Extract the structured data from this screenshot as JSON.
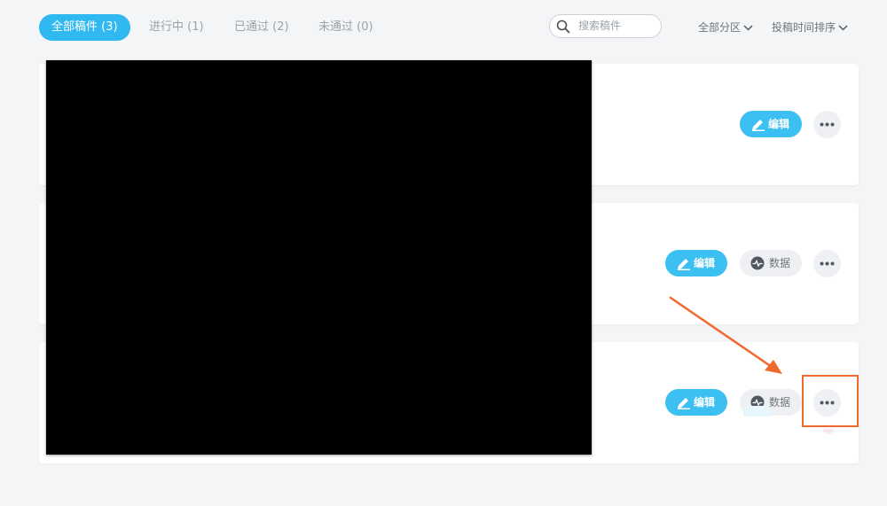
{
  "tabs": [
    {
      "label": "全部稿件 (3)",
      "active": true
    },
    {
      "label": "进行中 (1)",
      "active": false
    },
    {
      "label": "已通过 (2)",
      "active": false
    },
    {
      "label": "未通过 (0)",
      "active": false
    }
  ],
  "search": {
    "placeholder": "搜索稿件"
  },
  "filters": {
    "category_label": "全部分区",
    "sort_label": "投稿时间排序"
  },
  "cards": [
    {
      "edit_label": "编辑",
      "has_data": false,
      "data_label": ""
    },
    {
      "edit_label": "编辑",
      "has_data": true,
      "data_label": "数据"
    },
    {
      "edit_label": "编辑",
      "has_data": true,
      "data_label": "数据"
    }
  ],
  "colors": {
    "accent": "#30b8f0",
    "annotation": "#ef6a2e",
    "page_bg": "#f4f5f7",
    "redacted": "#000000"
  },
  "icons": {
    "search": "search-icon",
    "chevron": "chevron-down-icon",
    "edit": "pencil-icon",
    "data": "pulse-icon",
    "more": "more-dots-icon"
  }
}
